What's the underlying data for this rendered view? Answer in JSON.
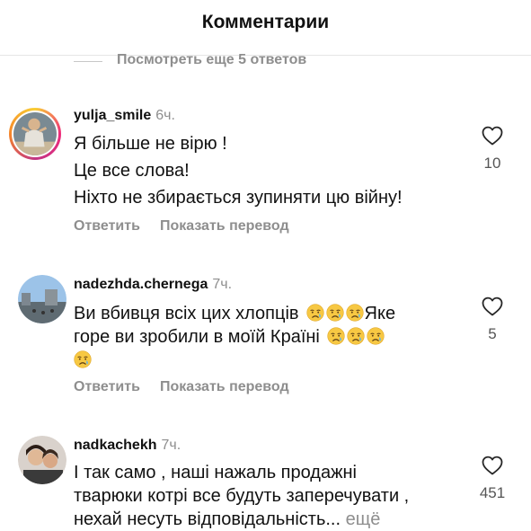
{
  "header": {
    "title": "Комментарии"
  },
  "replies_link": "Посмотреть еще 5 ответов",
  "comments": [
    {
      "username": "yulja_smile",
      "time": "6ч.",
      "lines": [
        "Я більше не вірю !",
        "Це все слова!",
        "Ніхто не збирається зупиняти цю війну!"
      ],
      "likes": "10",
      "reply": "Ответить",
      "translate": "Показать перевод"
    },
    {
      "username": "nadezhda.chernega",
      "time": "7ч.",
      "line1": "Ви вбивця всіх цих хлопців",
      "line1_after": "Яке",
      "line2": "горе ви зробили в моїй Країні",
      "likes": "5",
      "reply": "Ответить",
      "translate": "Показать перевод"
    },
    {
      "username": "nadkachekh",
      "time": "7ч.",
      "lines": [
        "І так само , наші нажаль продажні",
        "тварюки котрі все будуть заперечувати ,",
        "нехай несуть відповідальність..."
      ],
      "more": "ещё",
      "likes": "451"
    }
  ],
  "icons": {
    "like": "heart-outline-icon",
    "emoji": "crying-face-emoji"
  }
}
